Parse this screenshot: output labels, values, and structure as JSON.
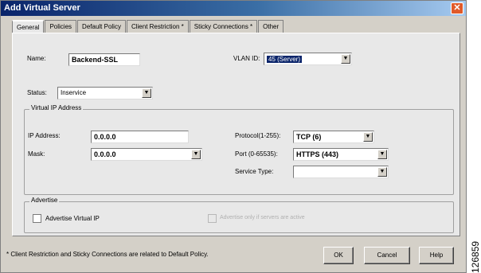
{
  "window": {
    "title": "Add Virtual Server",
    "close_glyph": "✕"
  },
  "tabs": [
    {
      "label": "General",
      "active": true
    },
    {
      "label": "Policies"
    },
    {
      "label": "Default Policy"
    },
    {
      "label": "Client Restriction *"
    },
    {
      "label": "Sticky Connections *"
    },
    {
      "label": "Other"
    }
  ],
  "general": {
    "name_label": "Name:",
    "name_value": "Backend-SSL",
    "vlan_label": "VLAN ID:",
    "vlan_value": "45 (Server)",
    "status_label": "Status:",
    "status_value": "Inservice"
  },
  "virtual_ip": {
    "legend": "Virtual IP Address",
    "ip_label": "IP Address:",
    "ip_value": "0.0.0.0",
    "mask_label": "Mask:",
    "mask_value": "0.0.0.0",
    "protocol_label": "Protocol(1-255):",
    "protocol_value": "TCP (6)",
    "port_label": "Port (0-65535):",
    "port_value": "HTTPS (443)",
    "service_type_label": "Service Type:",
    "service_type_value": ""
  },
  "advertise": {
    "legend": "Advertise",
    "advertise_vip_label": "Advertise Virtual IP",
    "advertise_active_label": "Advertise only if servers are active"
  },
  "footer": {
    "note": "* Client Restriction and Sticky Connections are related to Default Policy.",
    "ok_label": "OK",
    "cancel_label": "Cancel",
    "help_label": "Help"
  },
  "figure_number": "126859",
  "icons": {
    "dropdown": "chevron-down-icon",
    "close": "close-icon"
  }
}
